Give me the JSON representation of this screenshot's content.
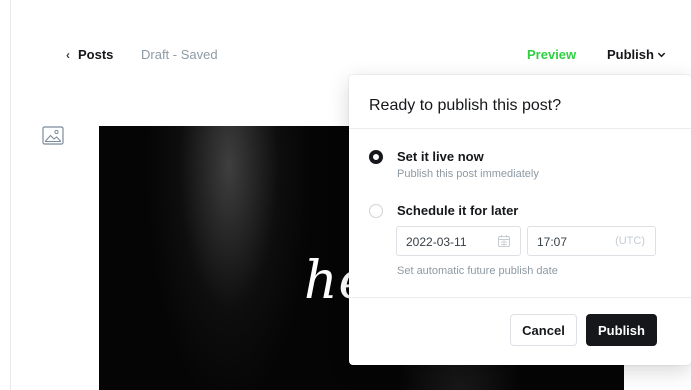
{
  "header": {
    "back_label": "Posts",
    "status": "Draft - Saved",
    "preview_label": "Preview",
    "publish_label": "Publish"
  },
  "feature_image": {
    "text": "he"
  },
  "publish_menu": {
    "title": "Ready to publish this post?",
    "options": [
      {
        "label": "Set it live now",
        "description": "Publish this post immediately",
        "selected": true
      },
      {
        "label": "Schedule it for later",
        "selected": false
      }
    ],
    "schedule": {
      "date": "2022-03-11",
      "time": "17:07",
      "timezone": "(UTC)",
      "hint": "Set automatic future publish date"
    },
    "cancel_label": "Cancel",
    "publish_label": "Publish"
  },
  "colors": {
    "accent_green": "#30cf43",
    "dark": "#15171a",
    "muted": "#8e9aa3"
  }
}
